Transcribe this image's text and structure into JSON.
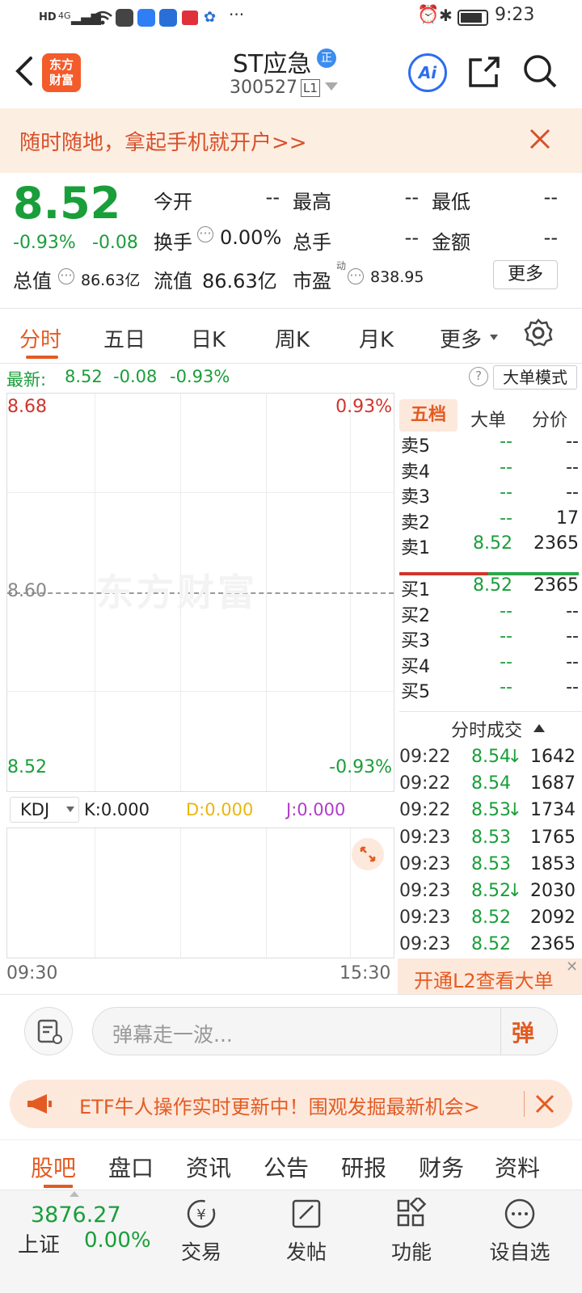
{
  "status": {
    "time": "9:23",
    "network": "4G"
  },
  "header": {
    "title": "ST应急",
    "badge": "正",
    "code": "300527",
    "level": "L1",
    "logo": "东方\n财富",
    "ai": "Ai"
  },
  "banner": {
    "text": "随时随地，拿起手机就开户>>"
  },
  "quote": {
    "price": "8.52",
    "pct": "-0.93%",
    "chg": "-0.08",
    "open_label": "今开",
    "open": "--",
    "high_label": "最高",
    "high": "--",
    "low_label": "最低",
    "low": "--",
    "turnover_label": "换手",
    "turnover": "0.00%",
    "volume_label": "总手",
    "volume": "--",
    "amount_label": "金额",
    "amount": "--",
    "mcap_label": "总值",
    "mcap": "86.63亿",
    "float_label": "流值",
    "float": "86.63亿",
    "pe_label": "市盈",
    "pe_sup": "动",
    "pe": "838.95",
    "more": "更多"
  },
  "tabs": [
    "分时",
    "五日",
    "日K",
    "周K",
    "月K",
    "更多"
  ],
  "latest": {
    "label": "最新:",
    "price": "8.52",
    "chg": "-0.08",
    "pct": "-0.93%",
    "mode": "大单模式"
  },
  "chart": {
    "y_top": "8.68",
    "y_mid": "8.60",
    "y_bot": "8.52",
    "pct_top": "0.93%",
    "pct_bot": "-0.93%",
    "t_start": "09:30",
    "t_end": "15:30",
    "watermark": "东方财富"
  },
  "kdj": {
    "name": "KDJ",
    "k": "K:0.000",
    "d": "D:0.000",
    "j": "J:0.000"
  },
  "orderbook": {
    "tabs": [
      "五档",
      "大单",
      "分价"
    ],
    "asks": [
      {
        "label": "卖5",
        "price": "--",
        "vol": "--"
      },
      {
        "label": "卖4",
        "price": "--",
        "vol": "--"
      },
      {
        "label": "卖3",
        "price": "--",
        "vol": "--"
      },
      {
        "label": "卖2",
        "price": "--",
        "vol": "17"
      },
      {
        "label": "卖1",
        "price": "8.52",
        "vol": "2365"
      }
    ],
    "bids": [
      {
        "label": "买1",
        "price": "8.52",
        "vol": "2365"
      },
      {
        "label": "买2",
        "price": "--",
        "vol": "--"
      },
      {
        "label": "买3",
        "price": "--",
        "vol": "--"
      },
      {
        "label": "买4",
        "price": "--",
        "vol": "--"
      },
      {
        "label": "买5",
        "price": "--",
        "vol": "--"
      }
    ],
    "trades_title": "分时成交",
    "trades": [
      {
        "time": "09:22",
        "price": "8.54",
        "arrow": "↓",
        "vol": "1642"
      },
      {
        "time": "09:22",
        "price": "8.54",
        "arrow": "",
        "vol": "1687"
      },
      {
        "time": "09:22",
        "price": "8.53",
        "arrow": "↓",
        "vol": "1734"
      },
      {
        "time": "09:23",
        "price": "8.53",
        "arrow": "",
        "vol": "1765"
      },
      {
        "time": "09:23",
        "price": "8.53",
        "arrow": "",
        "vol": "1853"
      },
      {
        "time": "09:23",
        "price": "8.52",
        "arrow": "↓",
        "vol": "2030"
      },
      {
        "time": "09:23",
        "price": "8.52",
        "arrow": "",
        "vol": "2092"
      },
      {
        "time": "09:23",
        "price": "8.52",
        "arrow": "",
        "vol": "2365"
      }
    ],
    "l2": "开通L2查看大单"
  },
  "danmu": {
    "placeholder": "弹幕走一波...",
    "button": "弹"
  },
  "promo": {
    "text": "ETF牛人操作实时更新中！围观发掘最新机会>"
  },
  "bottom_tabs": [
    "股吧",
    "盘口",
    "资讯",
    "公告",
    "研报",
    "财务",
    "资料"
  ],
  "index": {
    "value": "3876.27",
    "name": "上证",
    "pct": "0.00%"
  },
  "bottom_bar": [
    "交易",
    "发帖",
    "功能",
    "设自选"
  ]
}
